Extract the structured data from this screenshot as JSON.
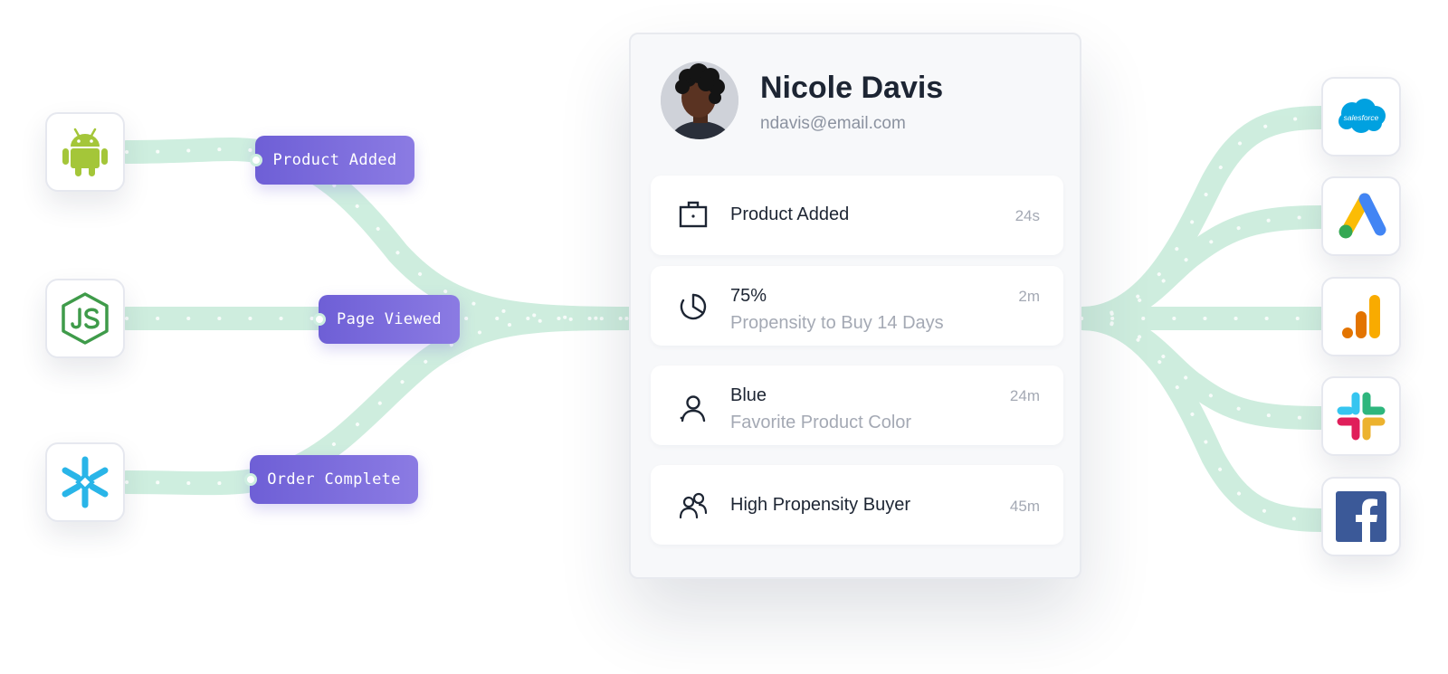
{
  "sources": [
    {
      "name": "android",
      "icon": "android-icon",
      "event": "Product Added"
    },
    {
      "name": "nodejs",
      "icon": "nodejs-icon",
      "event": "Page Viewed"
    },
    {
      "name": "snowflake",
      "icon": "snowflake-icon",
      "event": "Order Complete"
    }
  ],
  "profile": {
    "name": "Nicole Davis",
    "email": "ndavis@email.com",
    "rows": [
      {
        "icon": "briefcase-icon",
        "primary": "Product Added",
        "secondary": "",
        "time": "24s"
      },
      {
        "icon": "pie-chart-icon",
        "primary": "75%",
        "secondary": "Propensity to Buy 14 Days",
        "time": "2m"
      },
      {
        "icon": "user-icon",
        "primary": "Blue",
        "secondary": "Favorite Product Color",
        "time": "24m"
      },
      {
        "icon": "users-icon",
        "primary": "High Propensity Buyer",
        "secondary": "",
        "time": "45m"
      }
    ]
  },
  "destinations": [
    {
      "name": "salesforce",
      "icon": "salesforce-icon",
      "label": "salesforce"
    },
    {
      "name": "google-ads",
      "icon": "google-ads-icon"
    },
    {
      "name": "google-analytics",
      "icon": "google-analytics-icon"
    },
    {
      "name": "slack",
      "icon": "slack-icon"
    },
    {
      "name": "facebook",
      "icon": "facebook-icon"
    }
  ],
  "colors": {
    "flow": "#c9ecdb",
    "tag_start": "#6e5fd6",
    "tag_end": "#8b7be3",
    "title": "#1d2533",
    "muted": "#a4a9b4"
  }
}
